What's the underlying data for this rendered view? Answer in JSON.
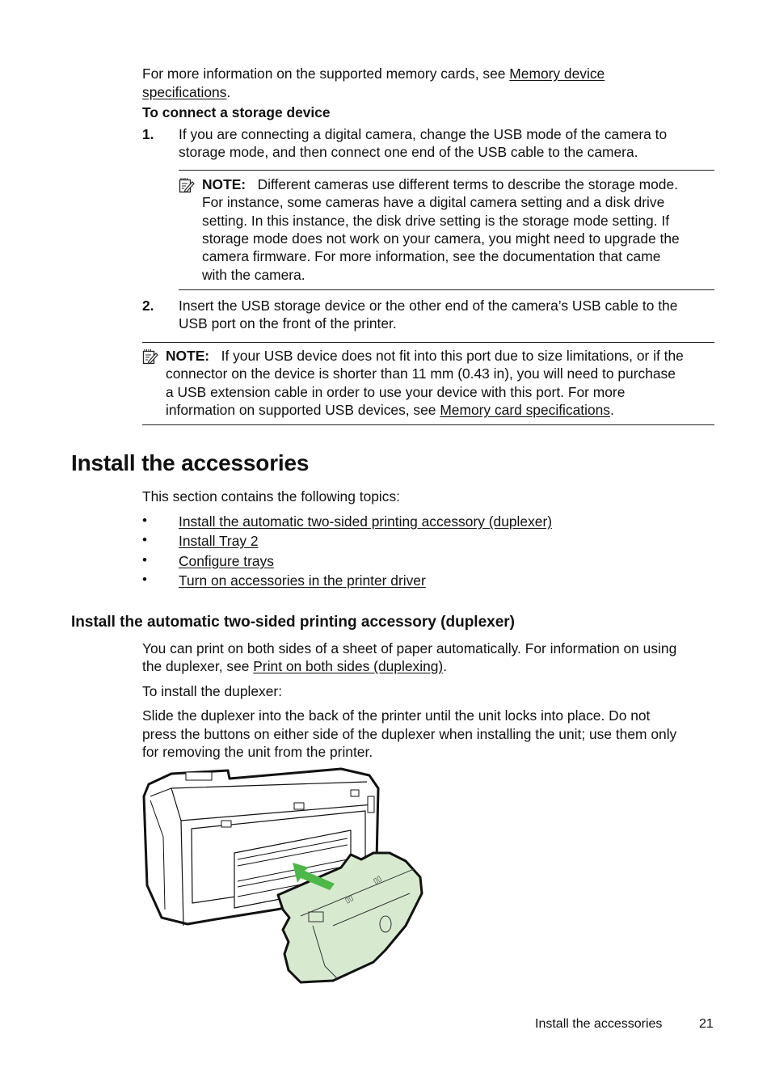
{
  "intro": {
    "text_before": "For more information on the supported memory cards, see ",
    "link_line1": "Memory device",
    "link_line2": "specifications",
    "text_after": "."
  },
  "procedure": {
    "heading": "To connect a storage device",
    "steps": [
      {
        "number": "1.",
        "lines": [
          "If you are connecting a digital camera, change the USB mode of the camera to",
          "storage mode, and then connect one end of the USB cable to the camera."
        ]
      },
      {
        "number": "2.",
        "lines": [
          "Insert the USB storage device or the other end of the camera’s USB cable to the",
          "USB port on the front of the printer."
        ]
      }
    ]
  },
  "note1": {
    "label": "NOTE:",
    "lines": [
      "Different cameras use different terms to describe the storage mode.",
      "For instance, some cameras have a digital camera setting and a disk drive",
      "setting. In this instance, the disk drive setting is the storage mode setting. If",
      "storage mode does not work on your camera, you might need to upgrade the",
      "camera firmware. For more information, see the documentation that came",
      "with the camera."
    ]
  },
  "note2": {
    "label": "NOTE:",
    "lines": [
      "If your USB device does not fit into this port due to size limitations, or if the",
      "connector on the device is shorter than 11 mm (0.43 in), you will need to purchase",
      "a USB extension cable in order to use your device with this port. For more"
    ],
    "last_line_before": "information on supported USB devices, see ",
    "last_line_link": "Memory card specifications",
    "last_line_after": "."
  },
  "section": {
    "title": "Install the accessories",
    "intro": "This section contains the following topics:",
    "bullet_char": "•",
    "topics": [
      "Install the automatic two-sided printing accessory (duplexer)",
      "Install Tray 2",
      "Configure trays",
      "Turn on accessories in the printer driver"
    ]
  },
  "subsection": {
    "title": "Install the automatic two-sided printing accessory (duplexer)",
    "para1_line1": "You can print on both sides of a sheet of paper automatically. For information on using",
    "para1_line2_before": "the duplexer, see ",
    "para1_link": "Print on both sides (duplexing)",
    "para1_line2_after": ".",
    "para2": "To install the duplexer:",
    "para3_lines": [
      "Slide the duplexer into the back of the printer until the unit locks into place. Do not",
      "press the buttons on either side of the duplexer when installing the unit; use them only",
      "for removing the unit from the printer."
    ],
    "figure": {
      "description": "Illustration of duplexer sliding into the back of the printer",
      "accent_color": "#4cb848",
      "duplexer_fill": "#d7ead0"
    }
  },
  "footer": {
    "section_name": "Install the accessories",
    "page_number": "21"
  }
}
